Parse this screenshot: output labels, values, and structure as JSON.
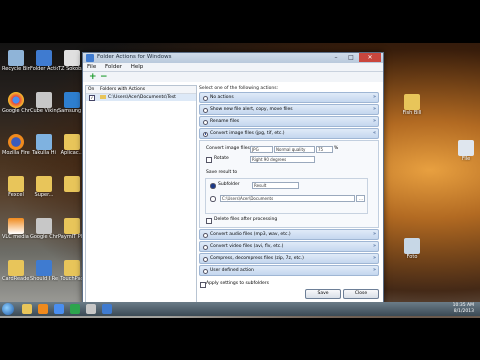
{
  "window": {
    "title": "Folder Actions for Windows",
    "controls": {
      "minimize": "–",
      "maximize": "□",
      "close": "✕"
    },
    "menu": [
      "File",
      "Folder",
      "Help"
    ],
    "toolbar": {
      "add": "+",
      "remove": "−"
    }
  },
  "left_pane": {
    "col_on": "On",
    "col_folders": "Folders with Actions",
    "rows": [
      {
        "checked": "✓",
        "path": "C:\\Users\\Acer\\Documents\\Test"
      }
    ]
  },
  "right_pane": {
    "header": "Select one of the following actions:",
    "actions_top": [
      "No actions",
      "Show new file alert, copy, move files",
      "Rename files"
    ],
    "action_selected": "Convert image files (jpg, tif, etc.)",
    "convert": {
      "label": "Convert image files to",
      "format": "JPG",
      "quality": "Normal quality",
      "percent": "75",
      "percent_sign": "%",
      "rotate_label": "Rotate",
      "rotate_value": "Right 90 degrees",
      "save_label": "Save result to",
      "subfolder_label": "Subfolder",
      "subfolder_value": "Result",
      "path_value": "C:\\Users\\Acer\\Documents",
      "browse": "...",
      "delete_label": "Delete files after processing"
    },
    "actions_bottom": [
      "Convert audio files (mp3, wav, etc.)",
      "Convert video files (avi, flv, etc.)",
      "Compress, decompress files (zip, 7z, etc.)",
      "User defined action"
    ]
  },
  "apply_label": "Apply settings to subfolders",
  "buttons": {
    "save": "Save",
    "close": "Close"
  },
  "desktop_icons_left": [
    "Recycle Bin",
    "Folder Actions",
    "TZ Sokoban",
    "Google Chrome",
    "Cube Vikings",
    "Samsung Kies",
    "Mozilla Firefox",
    "Takulla Hi",
    "Aplicac...",
    "Fexcel",
    "Super...",
    "",
    "VLC media player",
    "Google Chrome Rename",
    "PaymIT PL...",
    "CardReade...",
    "Should I Remove It",
    "TouchPad"
  ],
  "desktop_icons_right": [
    "Fish Bill",
    "File",
    "Foto"
  ],
  "clock": {
    "time": "10:35 AM",
    "date": "8/1/2013"
  }
}
